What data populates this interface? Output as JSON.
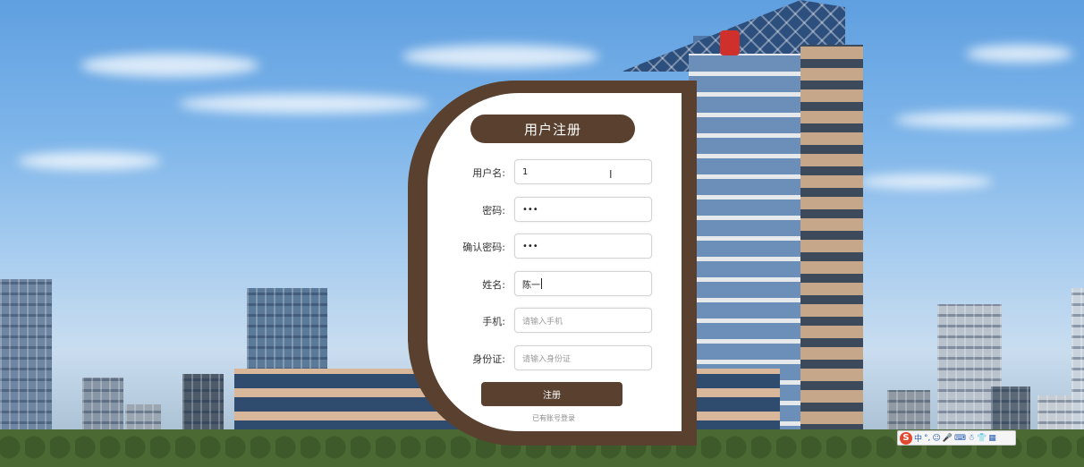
{
  "form": {
    "title": "用户注册",
    "fields": [
      {
        "label": "用户名:",
        "value": "1",
        "placeholder": ""
      },
      {
        "label": "密码:",
        "value": "•••",
        "placeholder": ""
      },
      {
        "label": "确认密码:",
        "value": "•••",
        "placeholder": ""
      },
      {
        "label": "姓名:",
        "value": "陈一",
        "placeholder": ""
      },
      {
        "label": "手机:",
        "value": "",
        "placeholder": "请输入手机"
      },
      {
        "label": "身份证:",
        "value": "",
        "placeholder": "请输入身份证"
      }
    ],
    "submit_label": "注册",
    "login_link": "已有账号登录"
  },
  "ime_toolbar": {
    "logo": "S",
    "mode": "中",
    "icons": [
      "punctuation-icon",
      "emoji-icon",
      "microphone-icon",
      "keyboard-icon",
      "user-icon",
      "shirt-icon",
      "grid-icon"
    ],
    "glyphs": [
      "°,",
      "☺",
      "🎤",
      "⌨",
      "☃",
      "👕",
      "▦"
    ]
  },
  "colors": {
    "accent": "#59402f",
    "card_bg": "#ffffff",
    "input_border": "#d4d4d4"
  }
}
